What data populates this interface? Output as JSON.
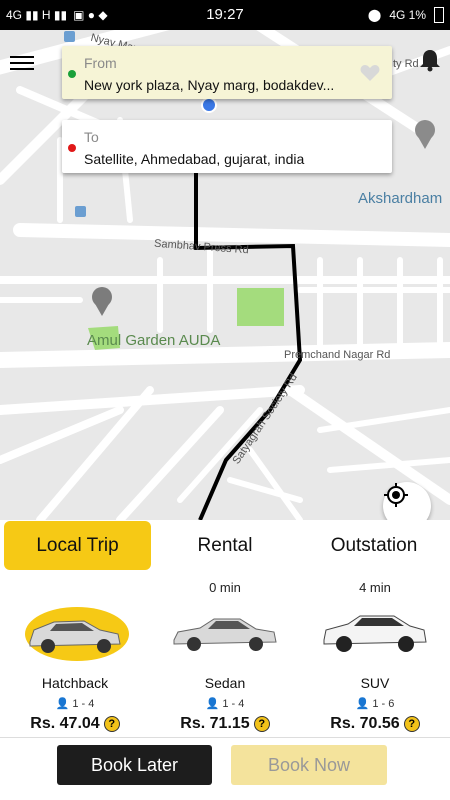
{
  "status": {
    "left": "4G  ▮▮  H ▮▮",
    "time": "19:27",
    "right": "4G  1%"
  },
  "route": {
    "from_label": "From",
    "from_value": "New york plaza, Nyay marg, bodakdev...",
    "to_label": "To",
    "to_value": "Satellite, Ahmedabad, gujarat, india"
  },
  "map": {
    "labels": {
      "akshardham": "Akshardham",
      "amul": "Amul Garden AUDA",
      "sambhav": "Sambhav Press Rd",
      "premchand": "Premchand Nagar Rd",
      "satyagrah": "Satyagrah Society Rd",
      "nyay": "Nyay Marg",
      "city": "ty Rd"
    }
  },
  "tabs": {
    "local": "Local Trip",
    "rental": "Rental",
    "outstation": "Outstation"
  },
  "cars": [
    {
      "name": "Hatchback",
      "eta": "",
      "seats": "1 - 4",
      "price": "Rs. 47.04"
    },
    {
      "name": "Sedan",
      "eta": "0 min",
      "seats": "1 - 4",
      "price": "Rs. 71.15"
    },
    {
      "name": "SUV",
      "eta": "4 min",
      "seats": "1 - 6",
      "price": "Rs. 70.56"
    }
  ],
  "buttons": {
    "book_later": "Book Later",
    "book_now": "Book Now"
  },
  "colors": {
    "accent": "#f6c915",
    "route": "#000000",
    "from_dot": "#1aa03a",
    "to_dot": "#e01818"
  }
}
